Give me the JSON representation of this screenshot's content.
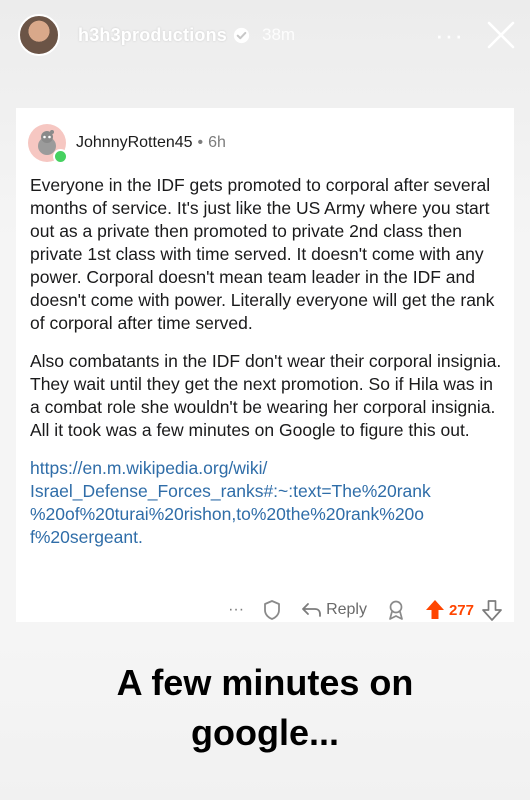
{
  "story": {
    "username": "h3h3productions",
    "time_ago": "38m",
    "more_label": "···"
  },
  "comment": {
    "username": "JohnnyRotten45",
    "dot": "•",
    "age": "6h",
    "paragraphs": [
      "Everyone in the IDF gets promoted to corporal after several months of service. It's just like the US Army where you start out as a private then promoted to private 2nd class then private 1st class with time served. It doesn't come with any power. Corporal doesn't mean team leader in the IDF and doesn't come with power. Literally everyone will get the rank of corporal after time served.",
      "Also combatants in the IDF don't wear their corporal insignia. They wait until they get the next promotion. So if Hila was in a combat role she wouldn't be wearing her corporal insignia. All it took was a few minutes on Google to figure this out."
    ],
    "link_lines": [
      "https://en.m.wikipedia.org/wiki/",
      "Israel_Defense_Forces_ranks#:~:text=The%20rank",
      "%20of%20turai%20rishon,to%20the%20rank%20o",
      "f%20sergeant."
    ],
    "actions": {
      "more": "···",
      "reply": "Reply",
      "votes": "277"
    }
  },
  "caption": {
    "line1": "A few minutes on",
    "line2": "google..."
  },
  "colors": {
    "upvote": "#ff4500",
    "link": "#2f6da8",
    "online": "#46d160"
  }
}
